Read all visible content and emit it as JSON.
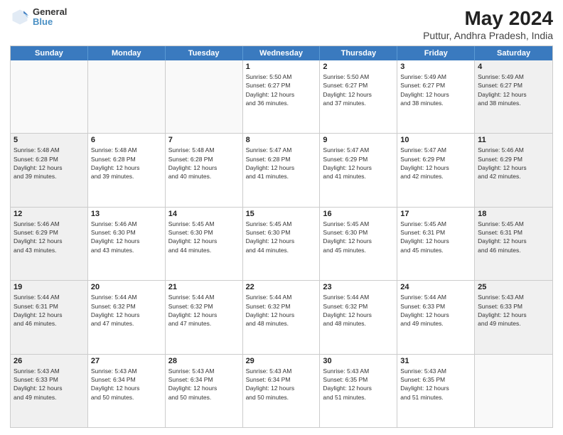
{
  "header": {
    "logo": {
      "line1": "General",
      "line2": "Blue"
    },
    "title": "May 2024",
    "subtitle": "Puttur, Andhra Pradesh, India"
  },
  "days_of_week": [
    "Sunday",
    "Monday",
    "Tuesday",
    "Wednesday",
    "Thursday",
    "Friday",
    "Saturday"
  ],
  "weeks": [
    [
      {
        "day": "",
        "info": "",
        "empty": true
      },
      {
        "day": "",
        "info": "",
        "empty": true
      },
      {
        "day": "",
        "info": "",
        "empty": true
      },
      {
        "day": "1",
        "info": "Sunrise: 5:50 AM\nSunset: 6:27 PM\nDaylight: 12 hours\nand 36 minutes."
      },
      {
        "day": "2",
        "info": "Sunrise: 5:50 AM\nSunset: 6:27 PM\nDaylight: 12 hours\nand 37 minutes."
      },
      {
        "day": "3",
        "info": "Sunrise: 5:49 AM\nSunset: 6:27 PM\nDaylight: 12 hours\nand 38 minutes."
      },
      {
        "day": "4",
        "info": "Sunrise: 5:49 AM\nSunset: 6:27 PM\nDaylight: 12 hours\nand 38 minutes.",
        "shaded": true
      }
    ],
    [
      {
        "day": "5",
        "info": "Sunrise: 5:48 AM\nSunset: 6:28 PM\nDaylight: 12 hours\nand 39 minutes.",
        "shaded": true
      },
      {
        "day": "6",
        "info": "Sunrise: 5:48 AM\nSunset: 6:28 PM\nDaylight: 12 hours\nand 39 minutes."
      },
      {
        "day": "7",
        "info": "Sunrise: 5:48 AM\nSunset: 6:28 PM\nDaylight: 12 hours\nand 40 minutes."
      },
      {
        "day": "8",
        "info": "Sunrise: 5:47 AM\nSunset: 6:28 PM\nDaylight: 12 hours\nand 41 minutes."
      },
      {
        "day": "9",
        "info": "Sunrise: 5:47 AM\nSunset: 6:29 PM\nDaylight: 12 hours\nand 41 minutes."
      },
      {
        "day": "10",
        "info": "Sunrise: 5:47 AM\nSunset: 6:29 PM\nDaylight: 12 hours\nand 42 minutes."
      },
      {
        "day": "11",
        "info": "Sunrise: 5:46 AM\nSunset: 6:29 PM\nDaylight: 12 hours\nand 42 minutes.",
        "shaded": true
      }
    ],
    [
      {
        "day": "12",
        "info": "Sunrise: 5:46 AM\nSunset: 6:29 PM\nDaylight: 12 hours\nand 43 minutes.",
        "shaded": true
      },
      {
        "day": "13",
        "info": "Sunrise: 5:46 AM\nSunset: 6:30 PM\nDaylight: 12 hours\nand 43 minutes."
      },
      {
        "day": "14",
        "info": "Sunrise: 5:45 AM\nSunset: 6:30 PM\nDaylight: 12 hours\nand 44 minutes."
      },
      {
        "day": "15",
        "info": "Sunrise: 5:45 AM\nSunset: 6:30 PM\nDaylight: 12 hours\nand 44 minutes."
      },
      {
        "day": "16",
        "info": "Sunrise: 5:45 AM\nSunset: 6:30 PM\nDaylight: 12 hours\nand 45 minutes."
      },
      {
        "day": "17",
        "info": "Sunrise: 5:45 AM\nSunset: 6:31 PM\nDaylight: 12 hours\nand 45 minutes."
      },
      {
        "day": "18",
        "info": "Sunrise: 5:45 AM\nSunset: 6:31 PM\nDaylight: 12 hours\nand 46 minutes.",
        "shaded": true
      }
    ],
    [
      {
        "day": "19",
        "info": "Sunrise: 5:44 AM\nSunset: 6:31 PM\nDaylight: 12 hours\nand 46 minutes.",
        "shaded": true
      },
      {
        "day": "20",
        "info": "Sunrise: 5:44 AM\nSunset: 6:32 PM\nDaylight: 12 hours\nand 47 minutes."
      },
      {
        "day": "21",
        "info": "Sunrise: 5:44 AM\nSunset: 6:32 PM\nDaylight: 12 hours\nand 47 minutes."
      },
      {
        "day": "22",
        "info": "Sunrise: 5:44 AM\nSunset: 6:32 PM\nDaylight: 12 hours\nand 48 minutes."
      },
      {
        "day": "23",
        "info": "Sunrise: 5:44 AM\nSunset: 6:32 PM\nDaylight: 12 hours\nand 48 minutes."
      },
      {
        "day": "24",
        "info": "Sunrise: 5:44 AM\nSunset: 6:33 PM\nDaylight: 12 hours\nand 49 minutes."
      },
      {
        "day": "25",
        "info": "Sunrise: 5:43 AM\nSunset: 6:33 PM\nDaylight: 12 hours\nand 49 minutes.",
        "shaded": true
      }
    ],
    [
      {
        "day": "26",
        "info": "Sunrise: 5:43 AM\nSunset: 6:33 PM\nDaylight: 12 hours\nand 49 minutes.",
        "shaded": true
      },
      {
        "day": "27",
        "info": "Sunrise: 5:43 AM\nSunset: 6:34 PM\nDaylight: 12 hours\nand 50 minutes."
      },
      {
        "day": "28",
        "info": "Sunrise: 5:43 AM\nSunset: 6:34 PM\nDaylight: 12 hours\nand 50 minutes."
      },
      {
        "day": "29",
        "info": "Sunrise: 5:43 AM\nSunset: 6:34 PM\nDaylight: 12 hours\nand 50 minutes."
      },
      {
        "day": "30",
        "info": "Sunrise: 5:43 AM\nSunset: 6:35 PM\nDaylight: 12 hours\nand 51 minutes."
      },
      {
        "day": "31",
        "info": "Sunrise: 5:43 AM\nSunset: 6:35 PM\nDaylight: 12 hours\nand 51 minutes."
      },
      {
        "day": "",
        "info": "",
        "empty": true
      }
    ]
  ]
}
